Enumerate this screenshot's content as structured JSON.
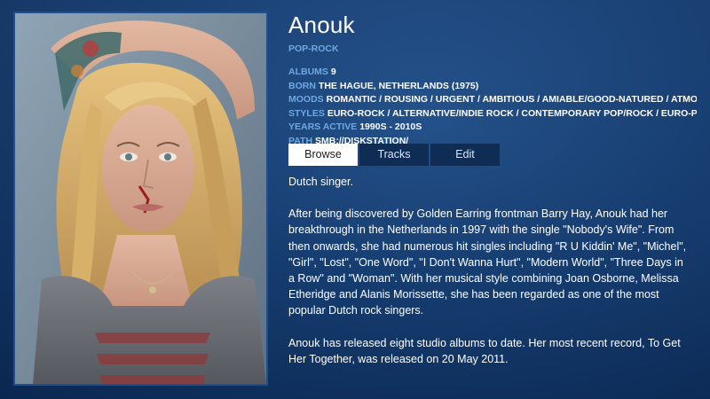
{
  "artist": {
    "name": "Anouk",
    "genre": "POP-ROCK"
  },
  "meta": {
    "albums_label": "ALBUMS",
    "albums_value": "9",
    "born_label": "BORN",
    "born_value": "THE HAGUE, NETHERLANDS (1975)",
    "moods_label": "MOODS",
    "moods_value": "ROMANTIC / ROUSING / URGENT / AMBITIOUS / AMIABLE/GOOD-NATURED / ATMOS...",
    "styles_label": "STYLES",
    "styles_value": "EURO-ROCK / ALTERNATIVE/INDIE ROCK / CONTEMPORARY POP/ROCK / EURO-POP",
    "years_label": "YEARS ACTIVE",
    "years_value": "1990S - 2010S",
    "path_label": "PATH",
    "path_value": "SMB://DISKSTATION/"
  },
  "tabs": {
    "browse": "Browse",
    "tracks": "Tracks",
    "edit": "Edit",
    "active": "browse"
  },
  "description": {
    "p1": "Dutch singer.",
    "p2": "After being discovered by Golden Earring frontman Barry Hay, Anouk had her breakthrough in the Netherlands in 1997 with the single \"Nobody's Wife\". From then onwards, she had numerous hit singles including \"R U Kiddin' Me\", \"Michel\", \"Girl\", \"Lost\", \"One Word\", \"I Don't Wanna Hurt\", \"Modern World\", \"Three Days in a Row\" and \"Woman\". With her musical style combining Joan Osborne, Melissa Etheridge and Alanis Morissette, she has been regarded as one of the most popular Dutch rock singers.",
    "p3": "Anouk has released eight studio albums to date. Her most recent record, To Get Her Together, was released on 20 May 2011."
  },
  "colors": {
    "accent": "#6fa8e0",
    "background": "#143d73",
    "tab_inactive": "#0f2c55",
    "tab_active": "#ffffff"
  }
}
